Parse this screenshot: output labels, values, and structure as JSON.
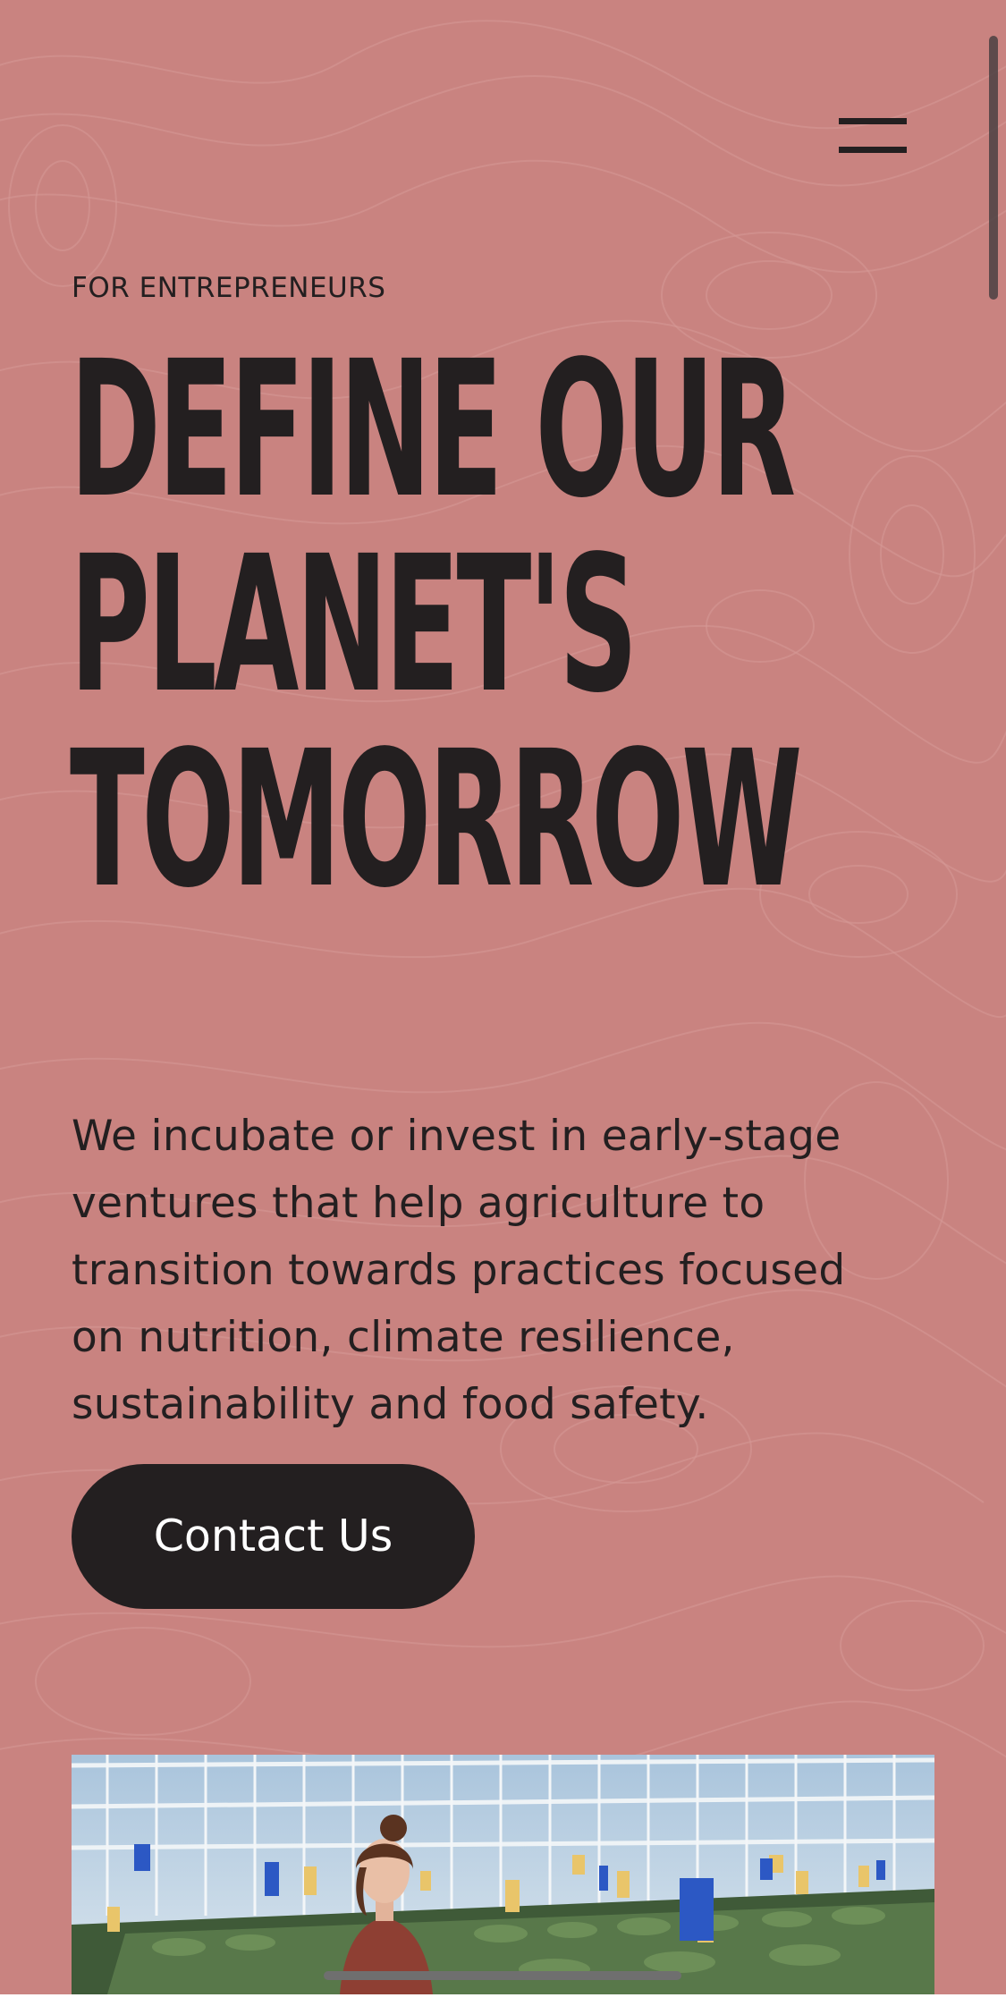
{
  "header": {
    "menu_icon": "hamburger-menu-icon"
  },
  "hero": {
    "eyebrow": "FOR ENTREPRENEURS",
    "headline_lines": [
      "DEFINE OUR",
      "PLANET'S",
      "TOMORROW"
    ],
    "intro_lines": [
      "We incubate or invest in early-stage",
      "ventures that help agriculture to",
      "transition towards practices focused",
      "on nutrition, climate resilience,",
      "sustainability and food safety."
    ],
    "cta_label": "Contact Us"
  },
  "colors": {
    "background": "#c98380",
    "text": "#231f20",
    "button": "#231f20",
    "button_text": "#ffffff"
  }
}
